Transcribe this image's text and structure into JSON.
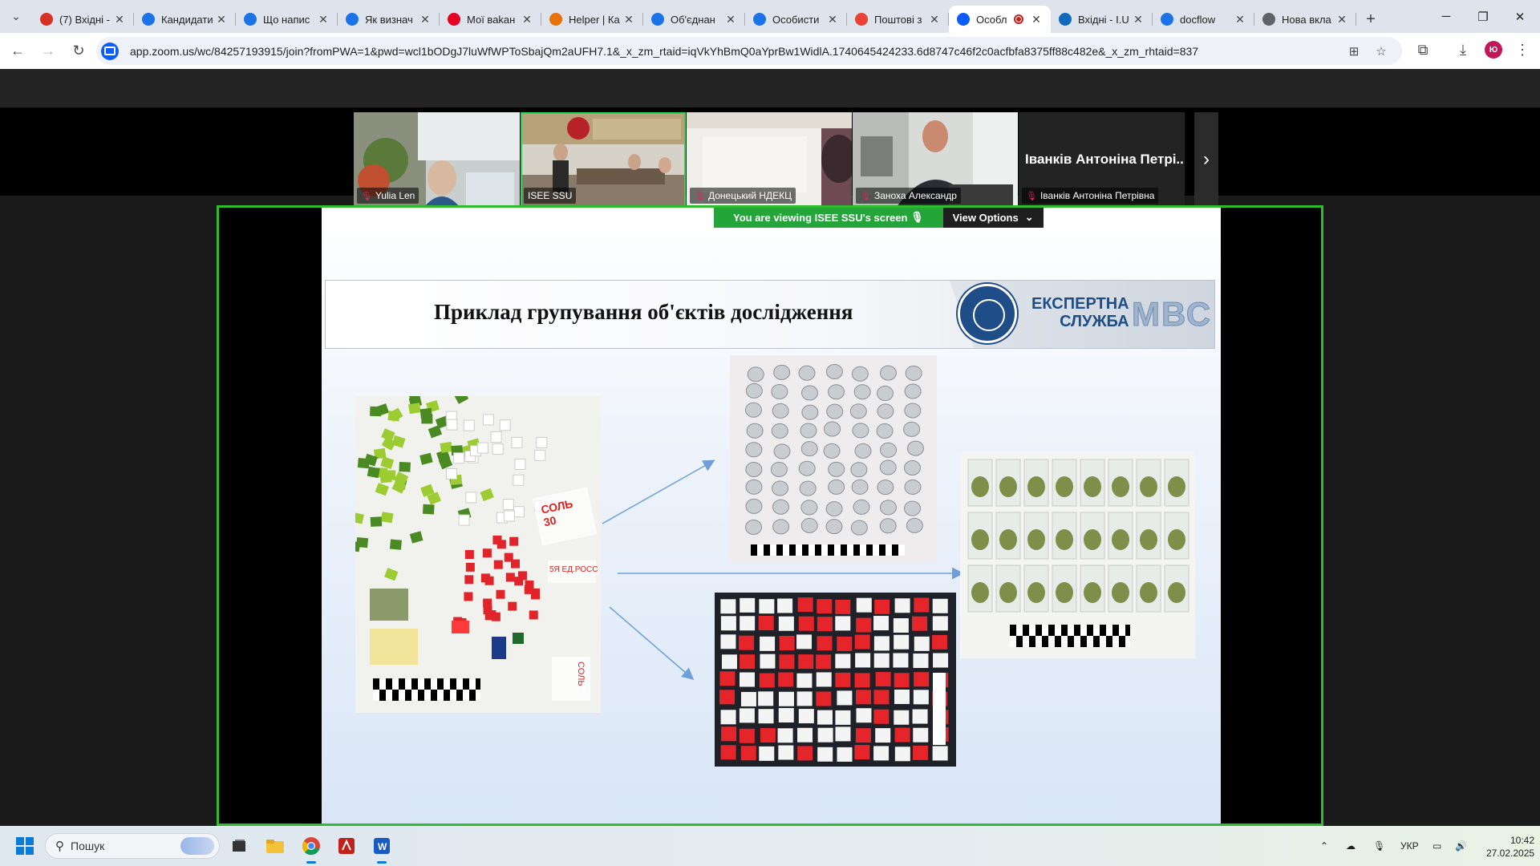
{
  "browser": {
    "tabs": [
      {
        "label": "(7) Вхідні -",
        "icon": "gmail-icon",
        "color": "#d93025"
      },
      {
        "label": "Кандидати",
        "icon": "site-icon",
        "color": "#1a73e8"
      },
      {
        "label": "Що напис",
        "icon": "site-icon",
        "color": "#1a73e8"
      },
      {
        "label": "Як визнач",
        "icon": "site-icon",
        "color": "#1a73e8"
      },
      {
        "label": "Мої ваkан",
        "icon": "pinterest-icon",
        "color": "#e60023"
      },
      {
        "label": "Helper | Ка",
        "icon": "helper-icon",
        "color": "#e8710a"
      },
      {
        "label": "Об'єднан",
        "icon": "site-icon",
        "color": "#1a73e8"
      },
      {
        "label": "Особисти",
        "icon": "site-icon",
        "color": "#1a73e8"
      },
      {
        "label": "Поштові з",
        "icon": "map-pin-icon",
        "color": "#ea4335"
      },
      {
        "label": "Особл",
        "icon": "zoom-icon",
        "color": "#0b5cff",
        "active": true
      },
      {
        "label": "Вхідні - I.U",
        "icon": "outlook-icon",
        "color": "#0f6cbd"
      },
      {
        "label": "docflow",
        "icon": "docflow-icon",
        "color": "#1a73e8"
      },
      {
        "label": "Нова вкла",
        "icon": "chrome-icon",
        "color": "#5f6368"
      }
    ],
    "url": "app.zoom.us/wc/84257193915/join?fromPWA=1&pwd=wcl1bODgJ7luWfWPToSbajQm2aUFH7.1&_x_zm_rtaid=iqVkYhBmQ0aYprBw1WidlA.1740645424233.6d8747c46f2c0acfbfa8375ff88c482e&_x_zm_rhtaid=837",
    "profile_initial": "Ю"
  },
  "zoom": {
    "participants": [
      {
        "name": "Yulia Len",
        "muted": true
      },
      {
        "name": "ISEE SSU",
        "muted": false,
        "speaking": true
      },
      {
        "name": "Донецький НДЕКЦ",
        "muted": true
      },
      {
        "name": "Заноха Александр",
        "muted": true
      },
      {
        "name": "Іванків Антоніна Петрівна",
        "muted": true,
        "tile_text": "Іванків Антоніна Петрі..."
      }
    ],
    "viewing_banner": "You are viewing  ISEE SSU's screen",
    "view_options": "View Options",
    "colors": {
      "share_border": "#2fbd2f",
      "banner": "#23a53a"
    }
  },
  "slide": {
    "title": "Приклад групування об'єктів дослідження",
    "logo_line1": "ЕКСПЕРТНА",
    "logo_line2": "СЛУЖБА",
    "logo_mvs": "МВС",
    "photo_labels": {
      "bag1_line1": "СОЛЬ",
      "bag1_line2": "30",
      "bag2": "5Я ЕД.РОСС",
      "bag3": "СОЛЬ"
    }
  },
  "taskbar": {
    "search_placeholder": "Пошук",
    "language": "УКР",
    "time": "10:42",
    "date": "27.02.2025"
  }
}
